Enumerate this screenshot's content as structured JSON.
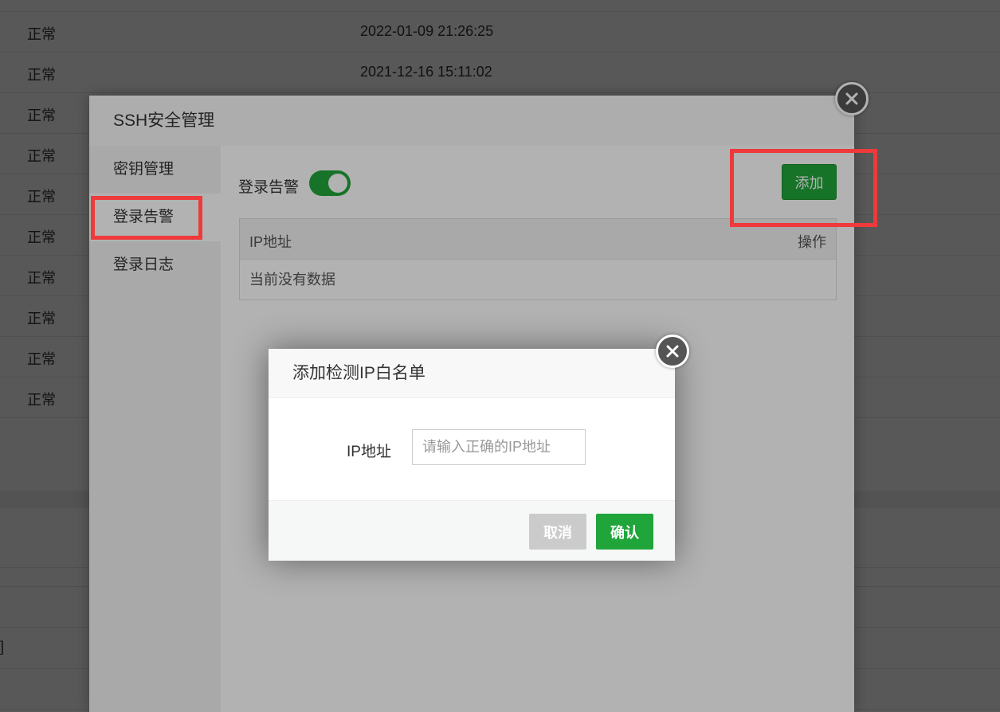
{
  "background": {
    "rows": [
      {
        "status": "正常",
        "time": "2022-01-09 21:26:25"
      },
      {
        "status": "正常",
        "time": "2021-12-16 15:11:02"
      },
      {
        "status": "正常",
        "time": ""
      },
      {
        "status": "正常",
        "time": ""
      },
      {
        "status": "正常",
        "time": ""
      },
      {
        "status": "正常",
        "time": ""
      },
      {
        "status": "正常",
        "time": ""
      },
      {
        "status": "正常",
        "time": ""
      },
      {
        "status": "正常",
        "time": ""
      },
      {
        "status": "正常",
        "time": ""
      }
    ],
    "bracket": "]"
  },
  "ssh_dialog": {
    "title": "SSH安全管理",
    "tabs": [
      {
        "label": "密钥管理",
        "active": false
      },
      {
        "label": "登录告警",
        "active": true
      },
      {
        "label": "登录日志",
        "active": false
      }
    ],
    "alarm_label": "登录告警",
    "alarm_enabled": true,
    "add_label": "添加",
    "table": {
      "columns": [
        "IP地址",
        "操作"
      ],
      "empty_text": "当前没有数据"
    }
  },
  "ip_dialog": {
    "title": "添加检测IP白名单",
    "field_label": "IP地址",
    "field_value": "",
    "field_placeholder": "请输入正确的IP地址",
    "cancel_label": "取消",
    "confirm_label": "确认"
  },
  "icons": {
    "close_outer": "close-icon",
    "close_inner": "close-icon"
  },
  "colors": {
    "accent_green": "#20a53a",
    "annotation_red": "#ee3a3a"
  }
}
